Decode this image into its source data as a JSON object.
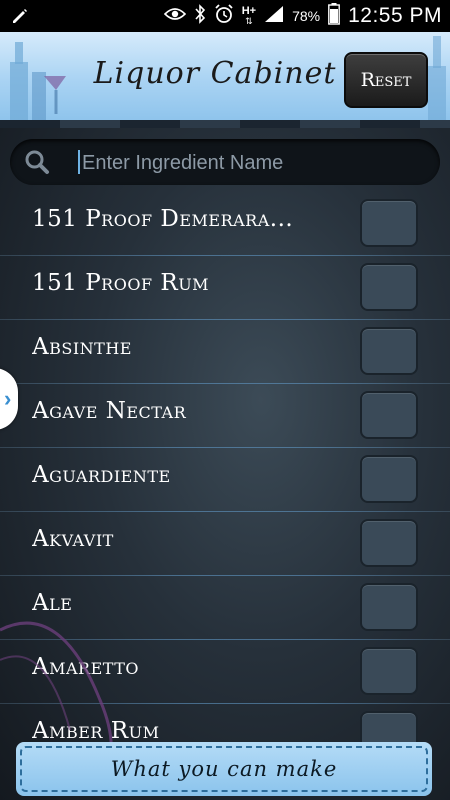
{
  "status_bar": {
    "battery": "78%",
    "time": "12:55 PM",
    "network": "H+",
    "icons": [
      "edit-icon",
      "eye-icon",
      "bluetooth-icon",
      "alarm-icon",
      "network-icon",
      "signal-icon",
      "battery-icon"
    ]
  },
  "header": {
    "title": "Liquor Cabinet",
    "reset_label": "Reset"
  },
  "search": {
    "placeholder": "Enter Ingredient Name",
    "value": ""
  },
  "ingredients": [
    {
      "label": "151 Proof Demerara...",
      "checked": false
    },
    {
      "label": "151 Proof Rum",
      "checked": false
    },
    {
      "label": "Absinthe",
      "checked": false
    },
    {
      "label": "Agave Nectar",
      "checked": false
    },
    {
      "label": "Aguardiente",
      "checked": false
    },
    {
      "label": "Akvavit",
      "checked": false
    },
    {
      "label": "Ale",
      "checked": false
    },
    {
      "label": "Amaretto",
      "checked": false
    },
    {
      "label": "Amber Rum",
      "checked": false
    }
  ],
  "footer": {
    "make_label": "What you can make"
  },
  "colors": {
    "header_blue": "#a9d3f3",
    "accent_blue": "#3a8fd0",
    "checkbox": "#3a4a58"
  }
}
